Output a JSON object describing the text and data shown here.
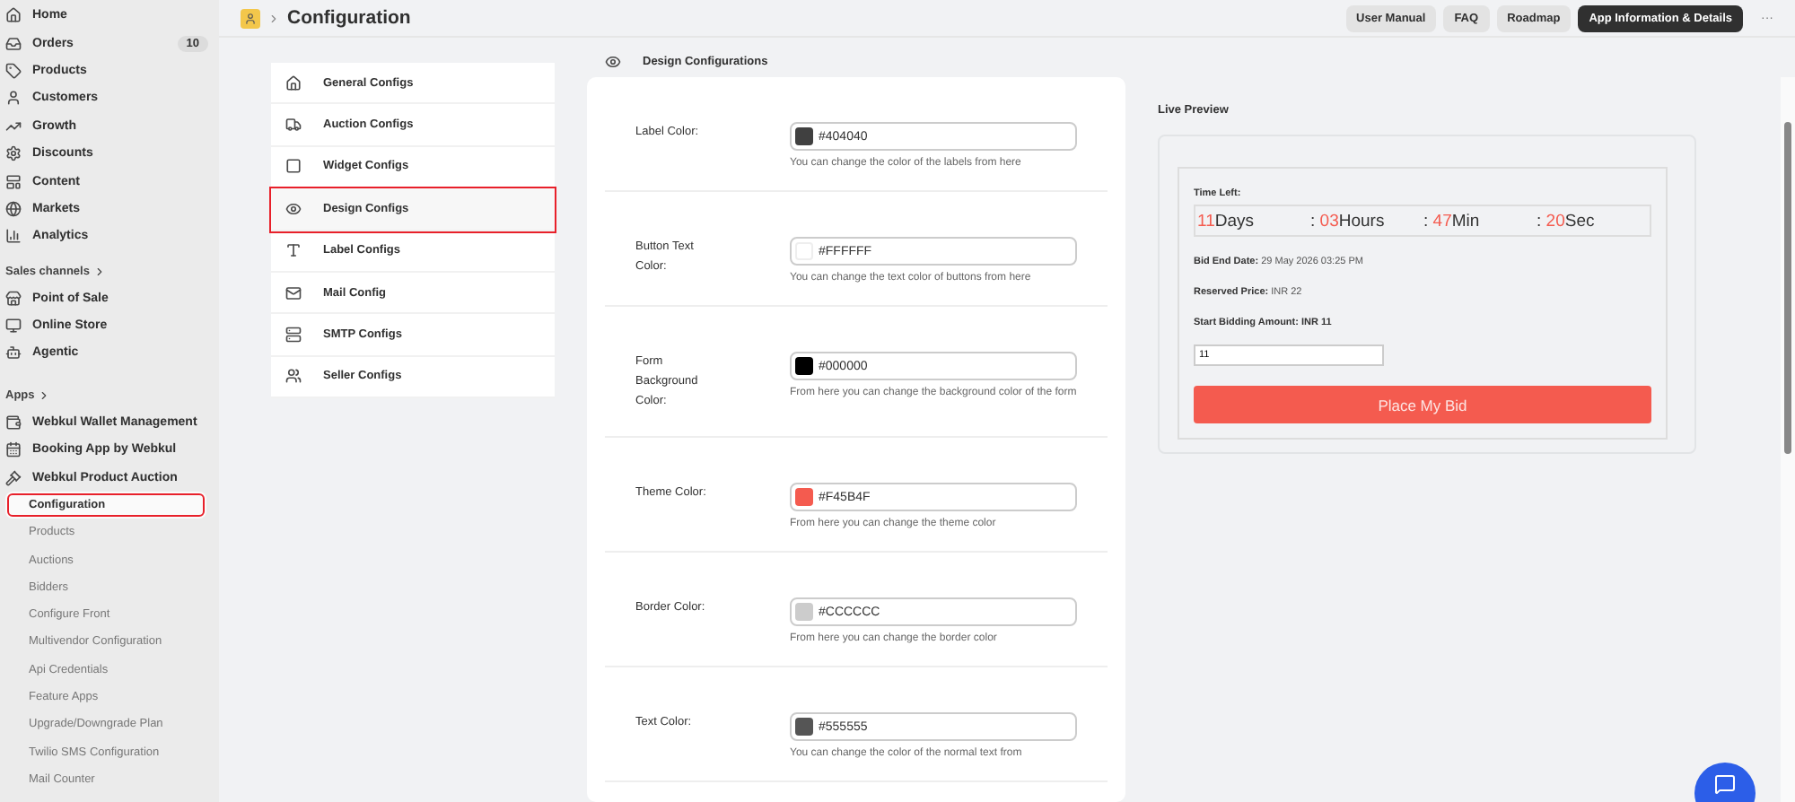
{
  "sidebar": {
    "main_items": [
      {
        "label": "Home"
      },
      {
        "label": "Orders",
        "badge": "10"
      },
      {
        "label": "Products"
      },
      {
        "label": "Customers"
      },
      {
        "label": "Growth"
      },
      {
        "label": "Discounts"
      },
      {
        "label": "Content"
      },
      {
        "label": "Markets"
      },
      {
        "label": "Analytics"
      }
    ],
    "sales_channels": {
      "heading": "Sales channels",
      "items": [
        {
          "label": "Point of Sale"
        },
        {
          "label": "Online Store"
        },
        {
          "label": "Agentic"
        }
      ]
    },
    "apps": {
      "heading": "Apps",
      "items": [
        {
          "label": "Webkul Wallet Management"
        },
        {
          "label": "Booking App by Webkul"
        },
        {
          "label": "Webkul Product Auction",
          "children": [
            {
              "label": "Configuration",
              "selected": true
            },
            {
              "label": "Products",
              "selected": false
            },
            {
              "label": "Auctions",
              "selected": false
            },
            {
              "label": "Bidders",
              "selected": false
            },
            {
              "label": "Configure Front",
              "selected": false
            },
            {
              "label": "Multivendor Configuration",
              "selected": false
            },
            {
              "label": "Api Credentials",
              "selected": false
            },
            {
              "label": "Feature Apps",
              "selected": false
            },
            {
              "label": "Upgrade/Downgrade Plan",
              "selected": false
            },
            {
              "label": "Twilio SMS Configuration",
              "selected": false
            },
            {
              "label": "Mail Counter",
              "selected": false
            }
          ]
        }
      ]
    }
  },
  "header": {
    "title": "Configuration",
    "buttons": [
      {
        "label": "User Manual",
        "kind": "plain"
      },
      {
        "label": "FAQ",
        "kind": "plain"
      },
      {
        "label": "Roadmap",
        "kind": "plain"
      },
      {
        "label": "App Information & Details",
        "kind": "dark"
      }
    ],
    "more": "···"
  },
  "config_menu": [
    {
      "label": "General Configs",
      "selected": false
    },
    {
      "label": "Auction Configs",
      "selected": false
    },
    {
      "label": "Widget Configs",
      "selected": false
    },
    {
      "label": "Design Configs",
      "selected": true
    },
    {
      "label": "Label Configs",
      "selected": false
    },
    {
      "label": "Mail Config",
      "selected": false
    },
    {
      "label": "SMTP Configs",
      "selected": false
    },
    {
      "label": "Seller Configs",
      "selected": false
    }
  ],
  "design": {
    "title": "Design Configurations",
    "rows": [
      {
        "label": "Label Color:",
        "value": "#404040",
        "color": "#404040",
        "help": "You can change the color of the labels from here"
      },
      {
        "label": "Button Text Color:",
        "value": "#FFFFFF",
        "color": "#ffffff",
        "help": "You can change the text color of buttons from here"
      },
      {
        "label": "Form Background Color:",
        "value": "#000000",
        "color": "#000000",
        "help": "From here you can change the background color of the form"
      },
      {
        "label": "Theme Color:",
        "value": "#F45B4F",
        "color": "#f45b4f",
        "help": "From here you can change the theme color"
      },
      {
        "label": "Border Color:",
        "value": "#CCCCCC",
        "color": "#cccccc",
        "help": "From here you can change the border color"
      },
      {
        "label": "Text Color:",
        "value": "#555555",
        "color": "#555555",
        "help": "You can change the color of the normal text from"
      }
    ]
  },
  "preview": {
    "title": "Live Preview",
    "time_left_label": "Time Left:",
    "timer": [
      {
        "value": "11",
        "unit": "Days"
      },
      {
        "separator": ":",
        "value": "03",
        "unit": "Hours"
      },
      {
        "separator": ":",
        "value": "47",
        "unit": "Min"
      },
      {
        "separator": ":",
        "value": "20",
        "unit": "Sec"
      }
    ],
    "details": [
      "**Bid End Date:** 29 May 2026 03:25 PM",
      "**Reserved Price:** INR 22",
      "**Start Bidding Amount: INR 11**"
    ],
    "bid_input": "11",
    "bid_button": "Place My Bid"
  }
}
